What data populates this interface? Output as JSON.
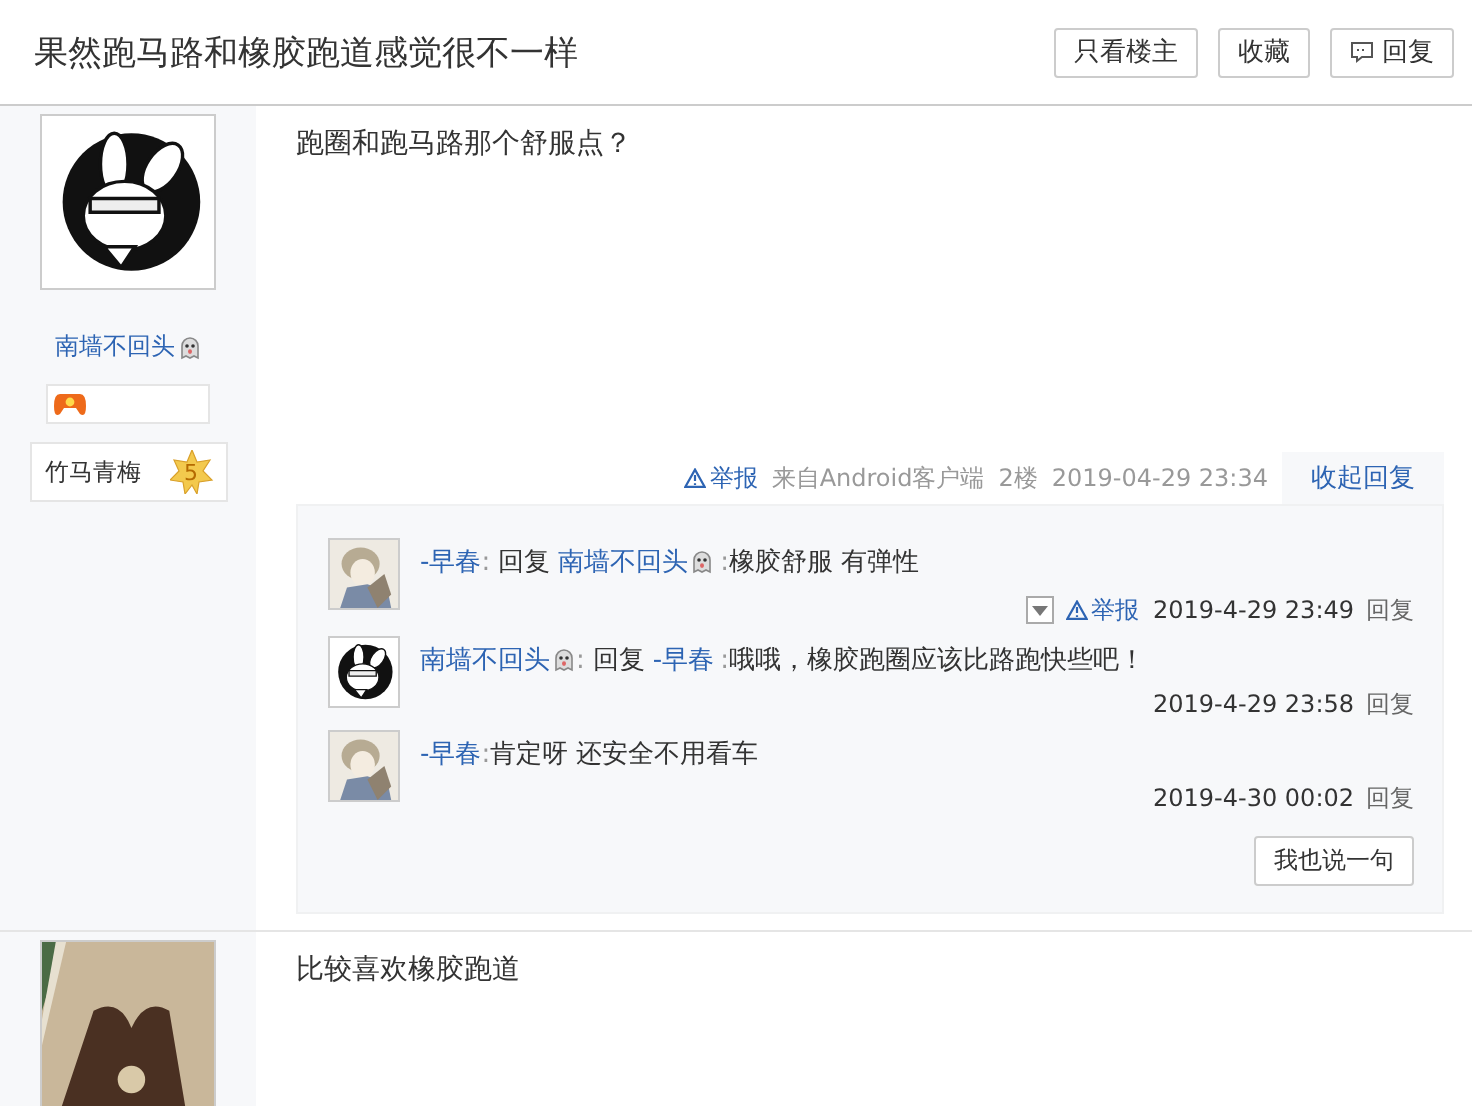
{
  "header": {
    "title": "果然跑马路和橡胶跑道感觉很不一样",
    "buttons": [
      {
        "label": "只看楼主",
        "icon": false
      },
      {
        "label": "收藏",
        "icon": false
      },
      {
        "label": "回复",
        "icon": true
      }
    ]
  },
  "posts": [
    {
      "author": {
        "name": "南墙不回头",
        "ghost": true,
        "badge": true,
        "tag": "竹马青梅",
        "tag_level": "5"
      },
      "text": "跑圈和跑马路那个舒服点？",
      "meta": {
        "report": "举报",
        "source": "来自Android客户端",
        "floor": "2楼",
        "time": "2019-04-29 23:34",
        "toggle": "收起回复"
      },
      "replies": [
        {
          "author": "-早春",
          "author_ghost": false,
          "colon": ":",
          "reply_label": "回复",
          "target": "南墙不回头",
          "target_ghost": true,
          "target_colon": ":",
          "text": "橡胶舒服 有弹性",
          "report": "举报",
          "time": "2019-4-29 23:49",
          "action": "回复"
        },
        {
          "author": "南墙不回头",
          "author_ghost": true,
          "colon": ":",
          "reply_label": "回复",
          "target": "-早春",
          "target_ghost": false,
          "target_colon": ":",
          "text": "哦哦，橡胶跑圈应该比路跑快些吧！",
          "time": "2019-4-29 23:58",
          "action": "回复"
        },
        {
          "author": "-早春",
          "author_ghost": false,
          "colon": ":",
          "text": "肯定呀 还安全不用看车",
          "time": "2019-4-30 00:02",
          "action": "回复"
        }
      ],
      "say_button": "我也说一句"
    },
    {
      "text": "比较喜欢橡胶跑道"
    }
  ]
}
